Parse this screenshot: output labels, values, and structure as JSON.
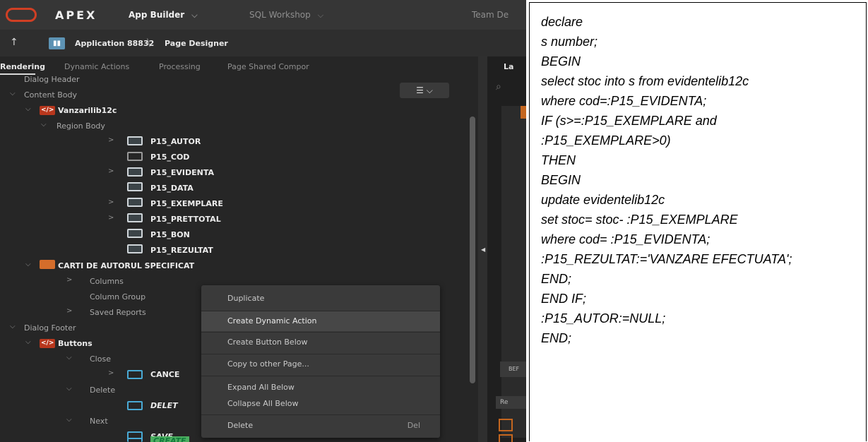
{
  "topbar": {
    "brand": "APEX",
    "nav": [
      {
        "label": "App Builder",
        "chevron": "⌵"
      },
      {
        "label": "SQL Workshop",
        "chevron": "⌵"
      },
      {
        "label": "Team De"
      }
    ]
  },
  "appbar": {
    "pin_icon": "↑",
    "app_icon": "bar-chart-icon",
    "app_label": "Application 88832",
    "page_label": "Page Designer"
  },
  "tabs": [
    "Rendering",
    "Dynamic Actions",
    "Processing",
    "Page Shared Compor"
  ],
  "right_panel": {
    "tab_label": "La",
    "button1": "BEF",
    "button2": "Re"
  },
  "tree": {
    "dialog_header": "Dialog Header",
    "content_body": "Content Body",
    "region1": "Vanzarilib12c",
    "region_body": "Region Body",
    "items": [
      "P15_AUTOR",
      "P15_COD",
      "P15_EVIDENTA",
      "P15_DATA",
      "P15_EXEMPLARE",
      "P15_PRETTOTAL",
      "P15_BON",
      "P15_REZULTAT"
    ],
    "report": "CARTI DE AUTORUL SPECIFICAT",
    "columns": "Columns",
    "column_groups": "Column Group",
    "saved_reports": "Saved Reports",
    "dialog_footer": "Dialog Footer",
    "buttons": "Buttons",
    "close": "Close",
    "cancel": "CANCE",
    "delete_group": "Delete",
    "delete_btn": "DELET",
    "next": "Next",
    "save": "SAVE",
    "create": "CREATE"
  },
  "context_menu": {
    "items": [
      "Duplicate",
      "Create Dynamic Action",
      "Create Button Below",
      "Copy to other Page...",
      "Expand All Below",
      "Collapse All Below",
      "Delete"
    ],
    "shortcut": "Del",
    "highlighted": "Create Dynamic Action"
  },
  "code_lines": [
    "declare",
    "s number;",
    "BEGIN",
    "select stoc into s from evidentelib12c",
    "where cod=:P15_EVIDENTA;",
    "IF (s>=:P15_EXEMPLARE and",
    ":P15_EXEMPLARE>0)",
    "THEN",
    "BEGIN",
    "update evidentelib12c",
    "set stoc= stoc- :P15_EXEMPLARE",
    "where cod= :P15_EVIDENTA;",
    ":P15_REZULTAT:='VANZARE EFECTUATA';",
    "END;",
    "END IF;",
    ":P15_AUTOR:=NULL;",
    "END;"
  ],
  "colors": {
    "brand_red": "#d03f24",
    "accent_blue": "#49a9d4",
    "region_orange": "#d46d2b",
    "html_red": "#b8371d"
  }
}
